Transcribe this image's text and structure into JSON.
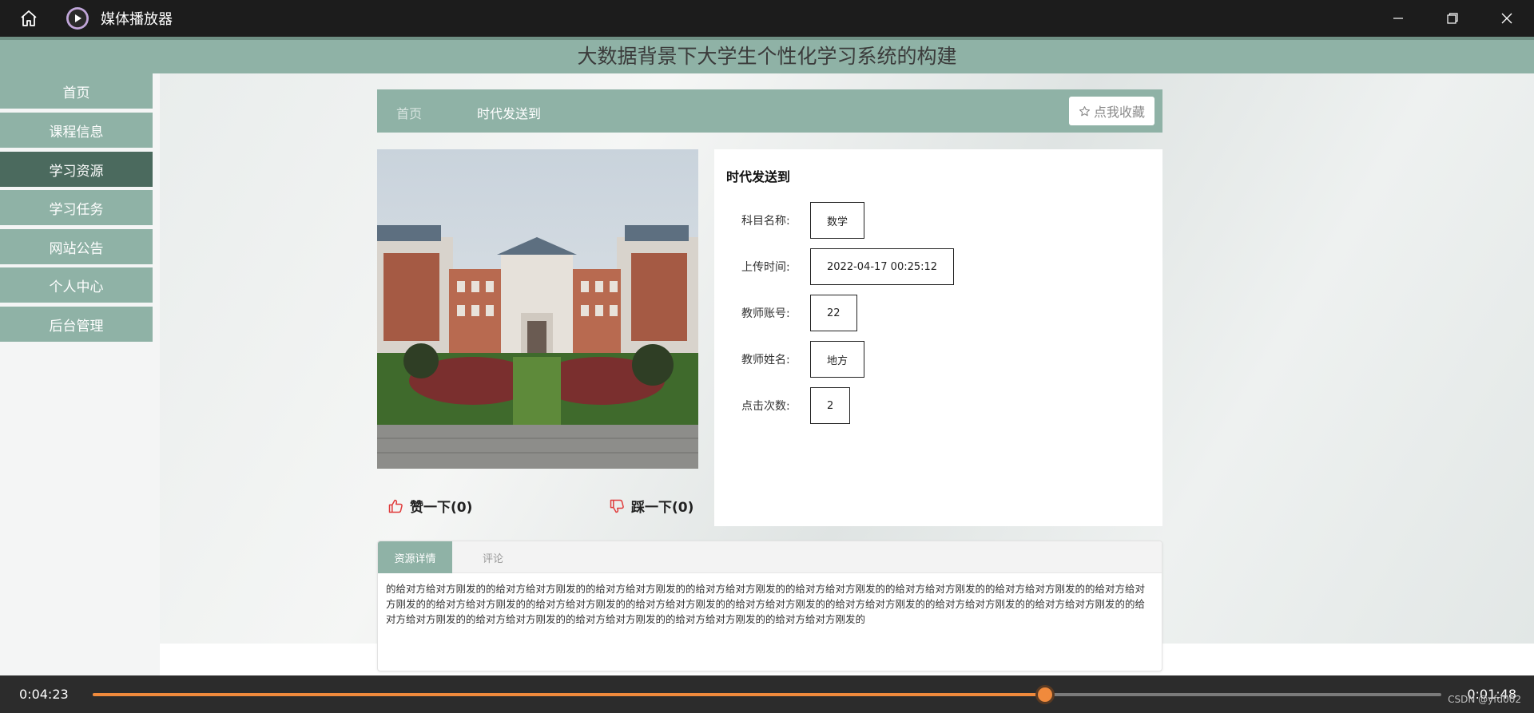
{
  "window": {
    "title": "媒体播放器"
  },
  "site": {
    "title": "大数据背景下大学生个性化学习系统的构建"
  },
  "sidebar": {
    "items": [
      {
        "label": "首页"
      },
      {
        "label": "课程信息"
      },
      {
        "label": "学习资源"
      },
      {
        "label": "学习任务"
      },
      {
        "label": "网站公告"
      },
      {
        "label": "个人中心"
      },
      {
        "label": "后台管理"
      }
    ],
    "active_index": 2
  },
  "breadcrumb": {
    "home": "首页",
    "current": "时代发送到"
  },
  "favorite_button": "点我收藏",
  "actions": {
    "like": "赞一下(0)",
    "dislike": "踩一下(0)"
  },
  "info": {
    "title": "时代发送到",
    "rows": [
      {
        "label": "科目名称:",
        "value": "数学"
      },
      {
        "label": "上传时间:",
        "value": "2022-04-17 00:25:12"
      },
      {
        "label": "教师账号:",
        "value": "22"
      },
      {
        "label": "教师姓名:",
        "value": "地方"
      },
      {
        "label": "点击次数:",
        "value": "2"
      }
    ]
  },
  "tabs": {
    "detail": "资源详情",
    "comment": "评论",
    "content": "的给对方给对方刚发的的给对方给对方刚发的的给对方给对方刚发的的给对方给对方刚发的的给对方给对方刚发的的给对方给对方刚发的的给对方给对方刚发的的给对方给对方刚发的的给对方给对方刚发的的给对方给对方刚发的的给对方给对方刚发的的给对方给对方刚发的的给对方给对方刚发的的给对方给对方刚发的的给对方给对方刚发的的给对方给对方刚发的的给对方给对方刚发的的给对方给对方刚发的的给对方给对方刚发的的给对方给对方刚发的"
  },
  "player": {
    "elapsed": "0:04:23",
    "remaining": "0:01:48",
    "progress": 0.706,
    "watermark": "CSDN @yfd002"
  },
  "colors": {
    "accent": "#8fb2a6",
    "active": "#4b6a5e",
    "progress": "#f08a3c",
    "titlebar": "#1c1c1c"
  }
}
